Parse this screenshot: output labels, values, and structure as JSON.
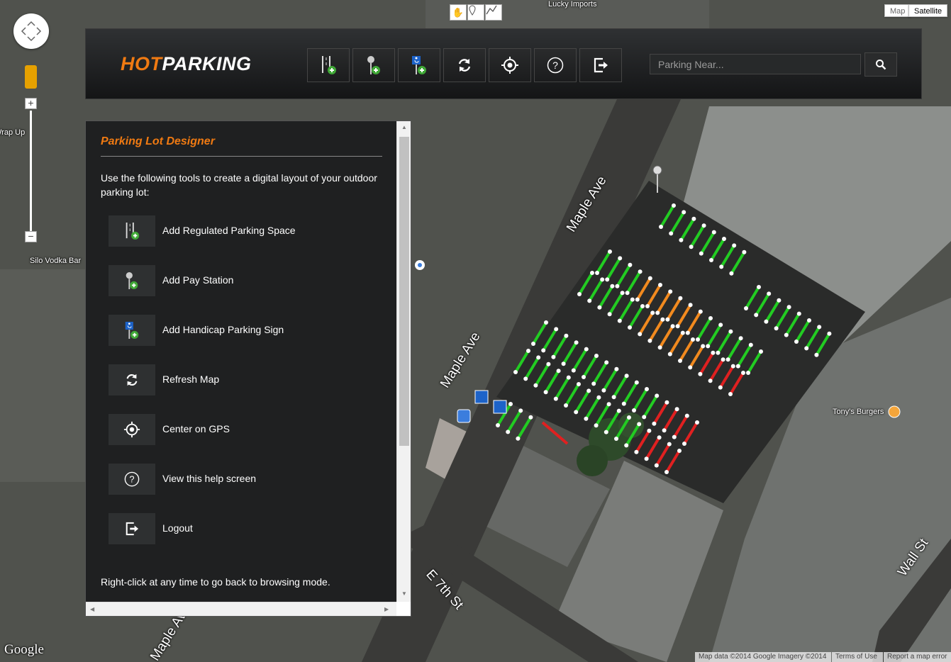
{
  "app": {
    "logo_hot": "HOT",
    "logo_parking": "PARKING"
  },
  "colors": {
    "accent": "#f07a12",
    "header_bg": "#1c1d1e",
    "panel_bg": "#1f2021",
    "space_free": "#22cc22",
    "space_paid": "#f28a1e",
    "space_violation": "#e02020"
  },
  "toolbar": {
    "buttons": [
      {
        "name": "add-regulated-space-button",
        "icon": "parking-space-add-icon"
      },
      {
        "name": "add-pay-station-button",
        "icon": "pay-station-add-icon"
      },
      {
        "name": "add-handicap-sign-button",
        "icon": "handicap-sign-add-icon"
      },
      {
        "name": "refresh-map-button",
        "icon": "refresh-icon"
      },
      {
        "name": "center-gps-button",
        "icon": "crosshair-icon"
      },
      {
        "name": "help-button",
        "icon": "question-icon"
      },
      {
        "name": "logout-button",
        "icon": "logout-icon"
      }
    ]
  },
  "search": {
    "placeholder": "Parking Near...",
    "button_icon": "search-icon"
  },
  "help_panel": {
    "title": "Parking Lot Designer",
    "intro": "Use the following tools to create a digital layout of your outdoor parking lot:",
    "items": [
      {
        "label": "Add Regulated Parking Space",
        "icon": "parking-space-add-icon"
      },
      {
        "label": "Add Pay Station",
        "icon": "pay-station-add-icon"
      },
      {
        "label": "Add Handicap Parking Sign",
        "icon": "handicap-sign-add-icon"
      },
      {
        "label": "Refresh Map",
        "icon": "refresh-icon"
      },
      {
        "label": "Center on GPS",
        "icon": "crosshair-icon"
      },
      {
        "label": "View this help screen",
        "icon": "question-icon"
      },
      {
        "label": "Logout",
        "icon": "logout-icon"
      }
    ],
    "footer": "Right-click at any time to go back to browsing mode."
  },
  "map": {
    "type_buttons": [
      "Map",
      "Satellite"
    ],
    "streets": [
      "Maple Ave",
      "Maple Ave",
      "Maple Ave",
      "E 7th St",
      "Wall St"
    ],
    "pois": [
      "Lucky Imports",
      "Silo Vodka Bar",
      "Tony's Burgers",
      "Wrap Up"
    ],
    "attribution": "Map data ©2014 Google Imagery ©2014",
    "terms": "Terms of Use",
    "report": "Report a map error",
    "google_logo": "Google"
  }
}
